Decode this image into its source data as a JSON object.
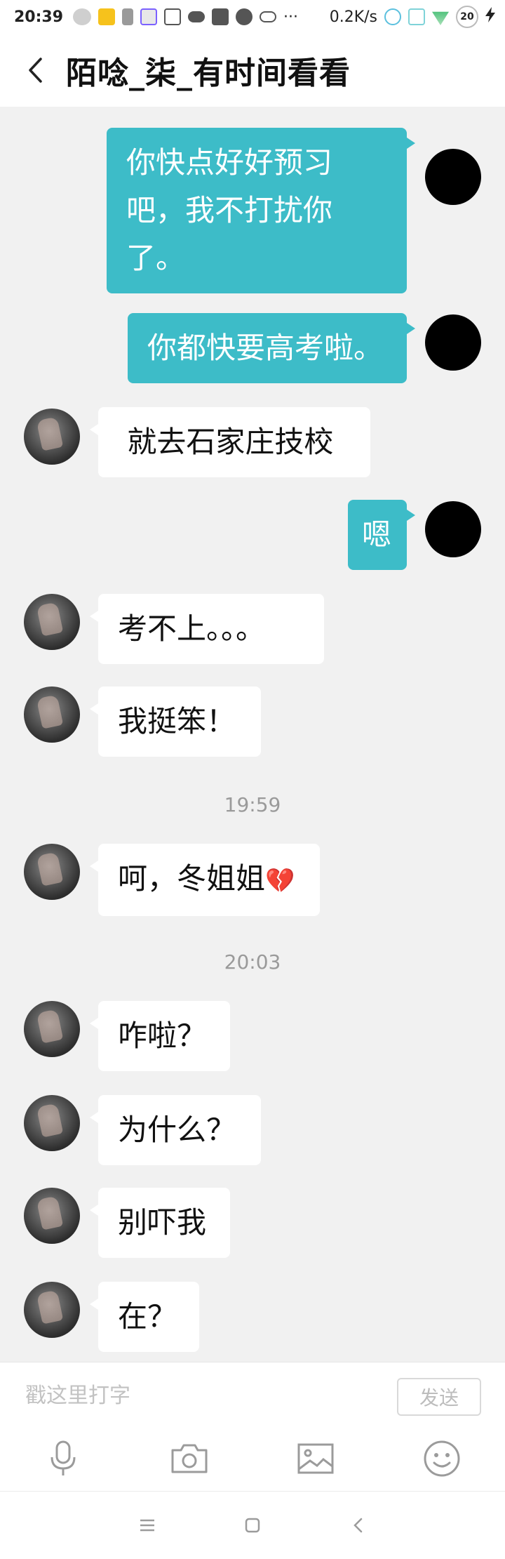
{
  "status_bar": {
    "time": "20:39",
    "network_speed": "0.2K/s",
    "battery": "20",
    "dots": "···"
  },
  "header": {
    "title": "陌唸_柒_有时间看看"
  },
  "messages": [
    {
      "from": "me",
      "text": "你快点好好预习吧，我不打扰你了。"
    },
    {
      "from": "me",
      "text": "你都快要高考啦。"
    },
    {
      "from": "other",
      "text": " 就去石家庄技校"
    },
    {
      "from": "me",
      "text": "嗯"
    },
    {
      "from": "other",
      "text": "考不上。。。"
    },
    {
      "from": "other",
      "text": "我挺笨！"
    },
    {
      "timestamp": "19:59"
    },
    {
      "from": "other",
      "text": "呵，冬姐姐",
      "emoji": "💔"
    },
    {
      "timestamp": "20:03"
    },
    {
      "from": "other",
      "text": "咋啦？"
    },
    {
      "from": "other",
      "text": "为什么？"
    },
    {
      "from": "other",
      "text": "别吓我"
    },
    {
      "from": "other",
      "text": "在？"
    }
  ],
  "input": {
    "placeholder": "戳这里打字",
    "send_label": "发送"
  },
  "toolbar": {
    "items": [
      "microphone-icon",
      "camera-icon",
      "image-icon",
      "emoji-icon"
    ]
  },
  "colors": {
    "my_bubble": "#3dbcc8",
    "other_bubble": "#ffffff",
    "background": "#f1f1f1"
  }
}
